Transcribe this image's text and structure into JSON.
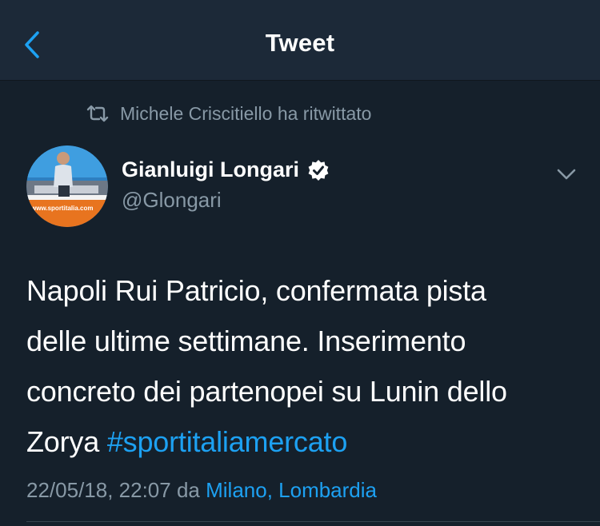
{
  "nav": {
    "title": "Tweet"
  },
  "retweet": {
    "text": "Michele Criscitiello ha ritwittato"
  },
  "author": {
    "name": "Gianluigi Longari",
    "handle": "@Glongari",
    "verified": true,
    "avatar_watermark": "www.sportitalia.com"
  },
  "tweet": {
    "line1": "Napoli Rui Patricio, confermata pista",
    "line2": "delle ultime settimane. Inserimento",
    "line3": "concreto dei partenopei su Lunin dello",
    "line4_prefix": "Zorya",
    "hashtag": "#sportitaliamercato"
  },
  "meta": {
    "timestamp": "22/05/18, 22:07",
    "via": "da",
    "location": "Milano, Lombardia"
  },
  "colors": {
    "background": "#15202b",
    "nav_background": "#1c2938",
    "accent": "#1da1f2",
    "secondary_text": "#8899a6"
  },
  "icons": {
    "back": "chevron-left-icon",
    "retweet": "retweet-icon",
    "verified": "verified-badge-icon",
    "more": "chevron-down-icon"
  }
}
